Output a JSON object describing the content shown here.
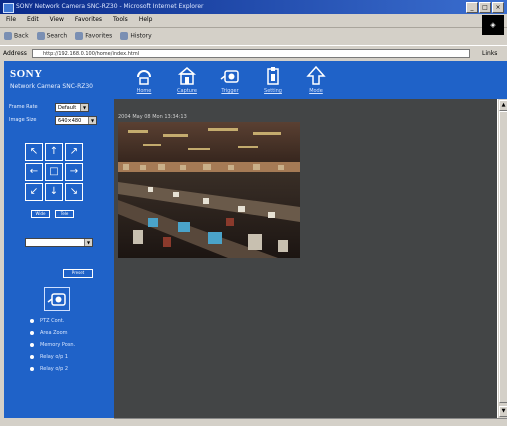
{
  "browser": {
    "title": "SONY Network Camera SNC-RZ30 - Microsoft Internet Explorer",
    "window_buttons": [
      "_",
      "□",
      "×"
    ],
    "menu": [
      "File",
      "Edit",
      "View",
      "Favorites",
      "Tools",
      "Help"
    ],
    "toolbar": [
      "Back",
      "Search",
      "Favorites",
      "History"
    ],
    "address_label": "Address",
    "address_value": "http://192.168.0.100/home/index.html",
    "go_label": "Links"
  },
  "camera": {
    "brand": "SONY",
    "model": "Network Camera SNC-RZ30",
    "top_buttons": [
      {
        "label": "Home",
        "icon": "home-icon"
      },
      {
        "label": "Capture",
        "icon": "capture-icon"
      },
      {
        "label": "Trigger",
        "icon": "trigger-icon"
      },
      {
        "label": "Setting",
        "icon": "setting-icon"
      },
      {
        "label": "Mode",
        "icon": "mode-icon"
      }
    ],
    "frame_rate_label": "Frame Rate",
    "frame_rate_value": "Default",
    "image_size_label": "Image Size",
    "image_size_value": "640×480",
    "info_line": "2004 May 08 Mon 13:34:13",
    "pan_tilt": {
      "up_left": "↖",
      "up": "↑",
      "up_right": "↗",
      "left": "←",
      "home": "□",
      "right": "→",
      "down_left": "↙",
      "down": "↓",
      "down_right": "↘"
    },
    "zoom_wide": "Wide",
    "zoom_tele": "Tele",
    "position_select": "",
    "preset_button_label": "Preset",
    "preset_options": [
      "PTZ Cont.",
      "Area Zoom",
      "Memory Posn.",
      "Relay o/p 1",
      "Relay o/p 2"
    ]
  },
  "colors": {
    "panel_blue": "#1f62c8",
    "main_bg": "#434546"
  }
}
